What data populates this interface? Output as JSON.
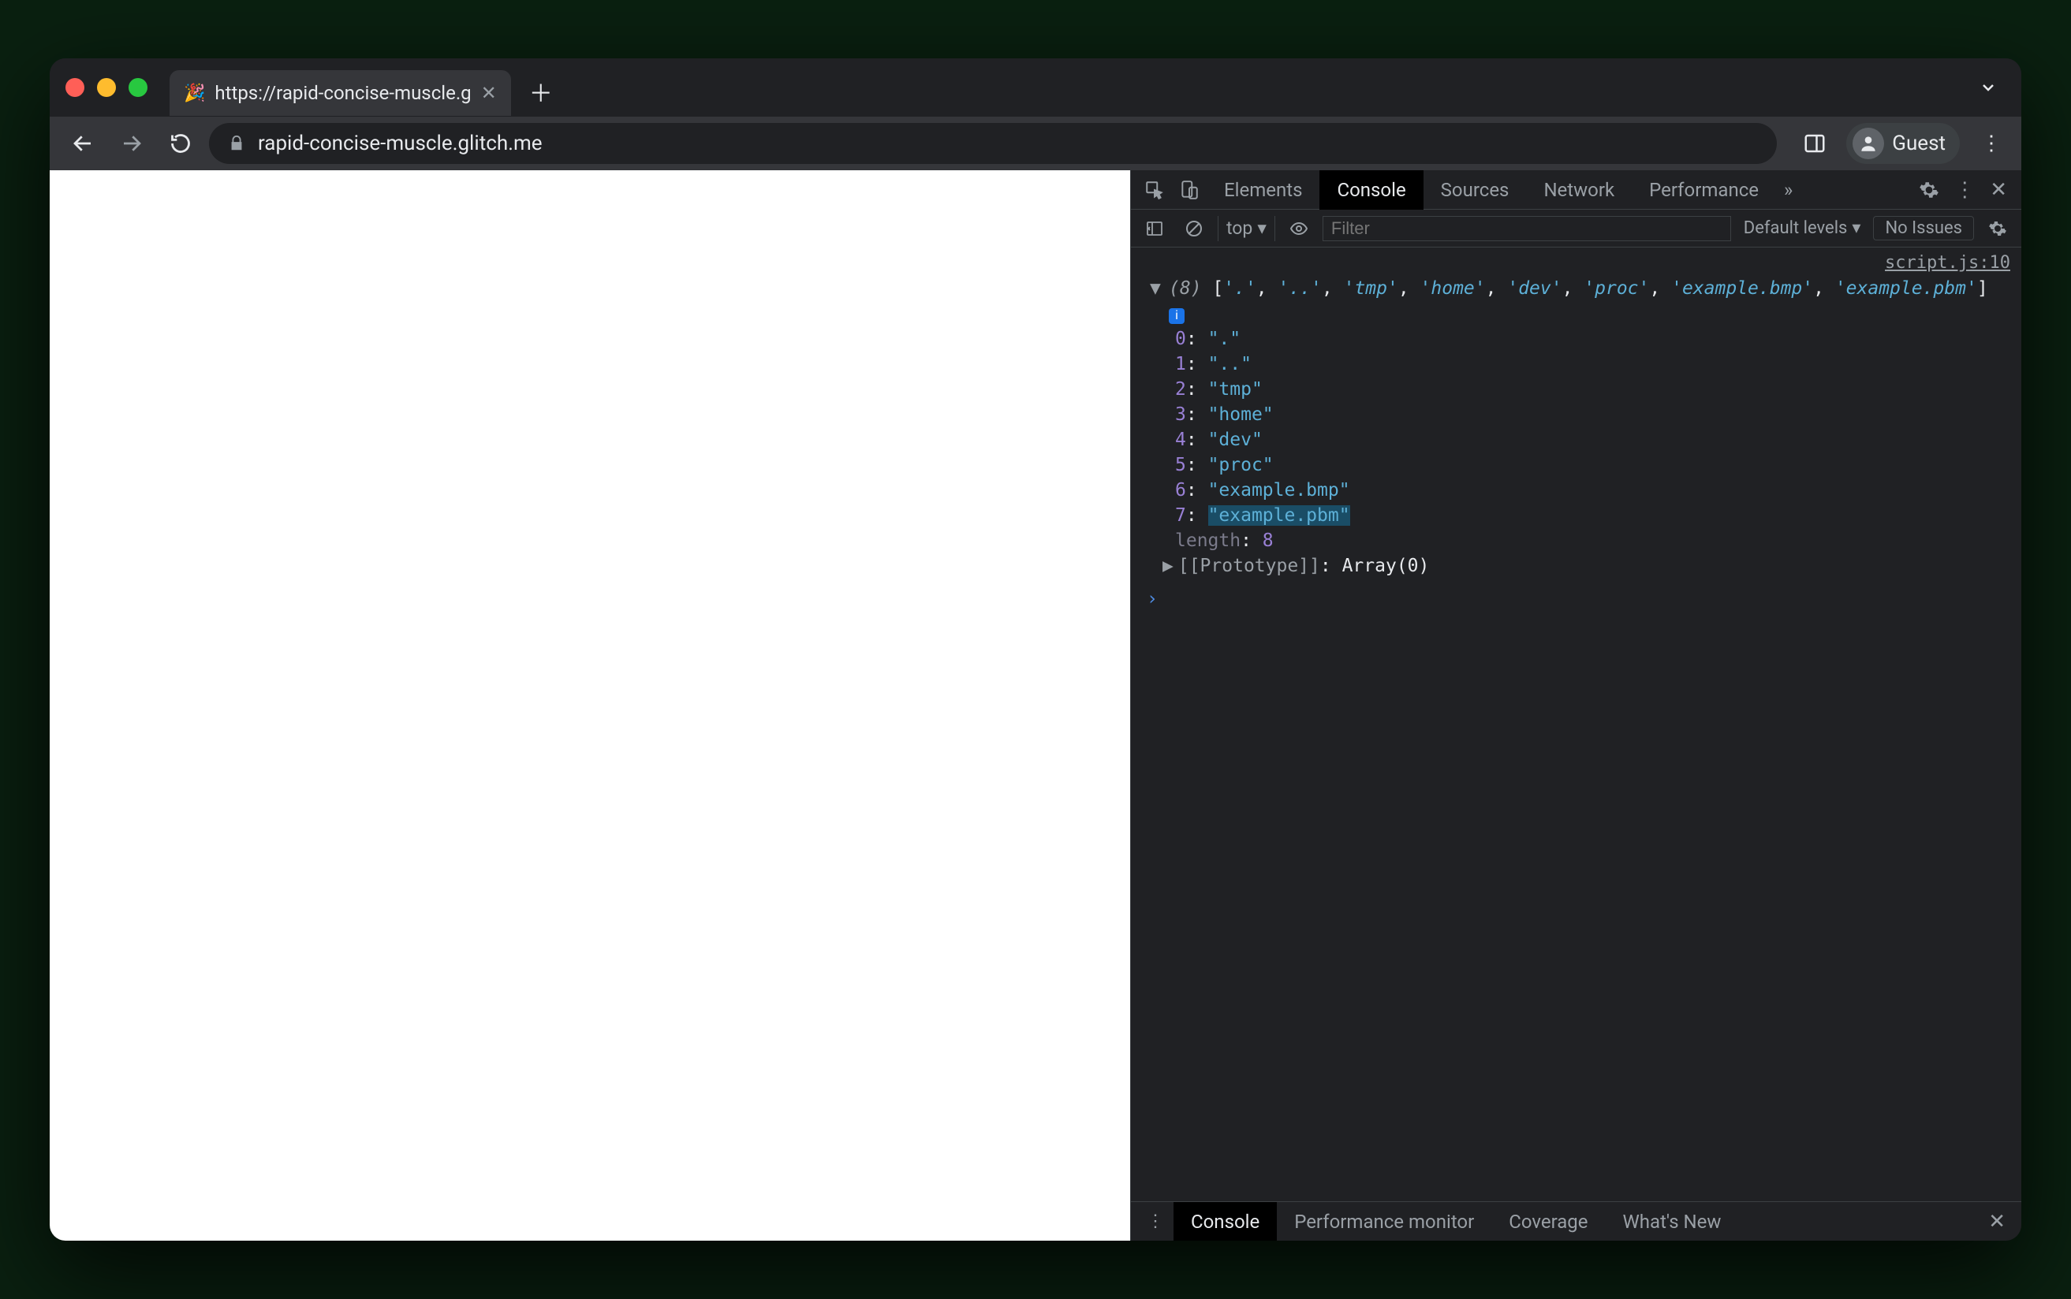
{
  "browser": {
    "tab_title": "https://rapid-concise-muscle.g",
    "favicon": "🎉",
    "url_display": "rapid-concise-muscle.glitch.me",
    "profile_label": "Guest"
  },
  "devtools": {
    "tabs": [
      "Elements",
      "Console",
      "Sources",
      "Network",
      "Performance"
    ],
    "active_tab": "Console",
    "toolbar": {
      "context": "top",
      "filter_placeholder": "Filter",
      "levels": "Default levels",
      "issues": "No Issues"
    },
    "source_link": "script.js:10",
    "log": {
      "count": 8,
      "summary_items": [
        ".",
        "..",
        "tmp",
        "home",
        "dev",
        "proc",
        "example.bmp",
        "example.pbm"
      ],
      "entries": [
        {
          "idx": "0",
          "val": "\".\""
        },
        {
          "idx": "1",
          "val": "\"..\""
        },
        {
          "idx": "2",
          "val": "\"tmp\""
        },
        {
          "idx": "3",
          "val": "\"home\""
        },
        {
          "idx": "4",
          "val": "\"dev\""
        },
        {
          "idx": "5",
          "val": "\"proc\""
        },
        {
          "idx": "6",
          "val": "\"example.bmp\""
        },
        {
          "idx": "7",
          "val": "\"example.pbm\""
        }
      ],
      "length_label": "length",
      "length_value": "8",
      "prototype_label": "[[Prototype]]",
      "prototype_value": "Array(0)"
    },
    "drawer": {
      "tabs": [
        "Console",
        "Performance monitor",
        "Coverage",
        "What's New"
      ],
      "active": "Console"
    }
  }
}
